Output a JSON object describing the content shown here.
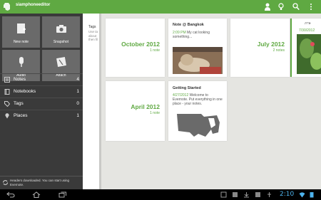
{
  "app": {
    "title": "siamphoneeditor"
  },
  "tiles": [
    {
      "label": "New note",
      "icon": "new-note-icon"
    },
    {
      "label": "Snapshot",
      "icon": "camera-icon"
    },
    {
      "label": "Audio",
      "icon": "microphone-icon"
    },
    {
      "label": "Attach",
      "icon": "attachment-icon"
    }
  ],
  "nav": [
    {
      "label": "Notes",
      "count": "4",
      "icon": "notes-icon"
    },
    {
      "label": "Notebooks",
      "count": "1",
      "icon": "notebook-icon"
    },
    {
      "label": "Tags",
      "count": "0",
      "icon": "tag-icon"
    },
    {
      "label": "Places",
      "count": "1",
      "icon": "place-pin-icon"
    }
  ],
  "status": {
    "text": "Headers downloaded. You can start using Evernote."
  },
  "peek": {
    "title": "Tags",
    "text": "Use ta\nabout\nthen fil"
  },
  "groups": [
    {
      "month": "October 2012",
      "count": "1 note"
    },
    {
      "month": "July 2012",
      "count": "2 notes"
    },
    {
      "month": "April 2012",
      "count": "1 note"
    }
  ],
  "notes": [
    {
      "title": "Note @ Bangkok",
      "time": "2:09 PM",
      "text": "My cat looking something..."
    },
    {
      "title": "Getting Started",
      "time": "4/27/2012",
      "text": "Welcome to Evernote. Put everything in one place - your notes."
    }
  ],
  "partial_note": {
    "date": "7/30/2012",
    "heading": "ภาษ"
  },
  "system": {
    "clock": "2:10"
  },
  "colors": {
    "accent": "#5fa942",
    "sidebar": "#3a3a3a",
    "background": "#e5e5e1",
    "clock": "#4db2ec"
  }
}
